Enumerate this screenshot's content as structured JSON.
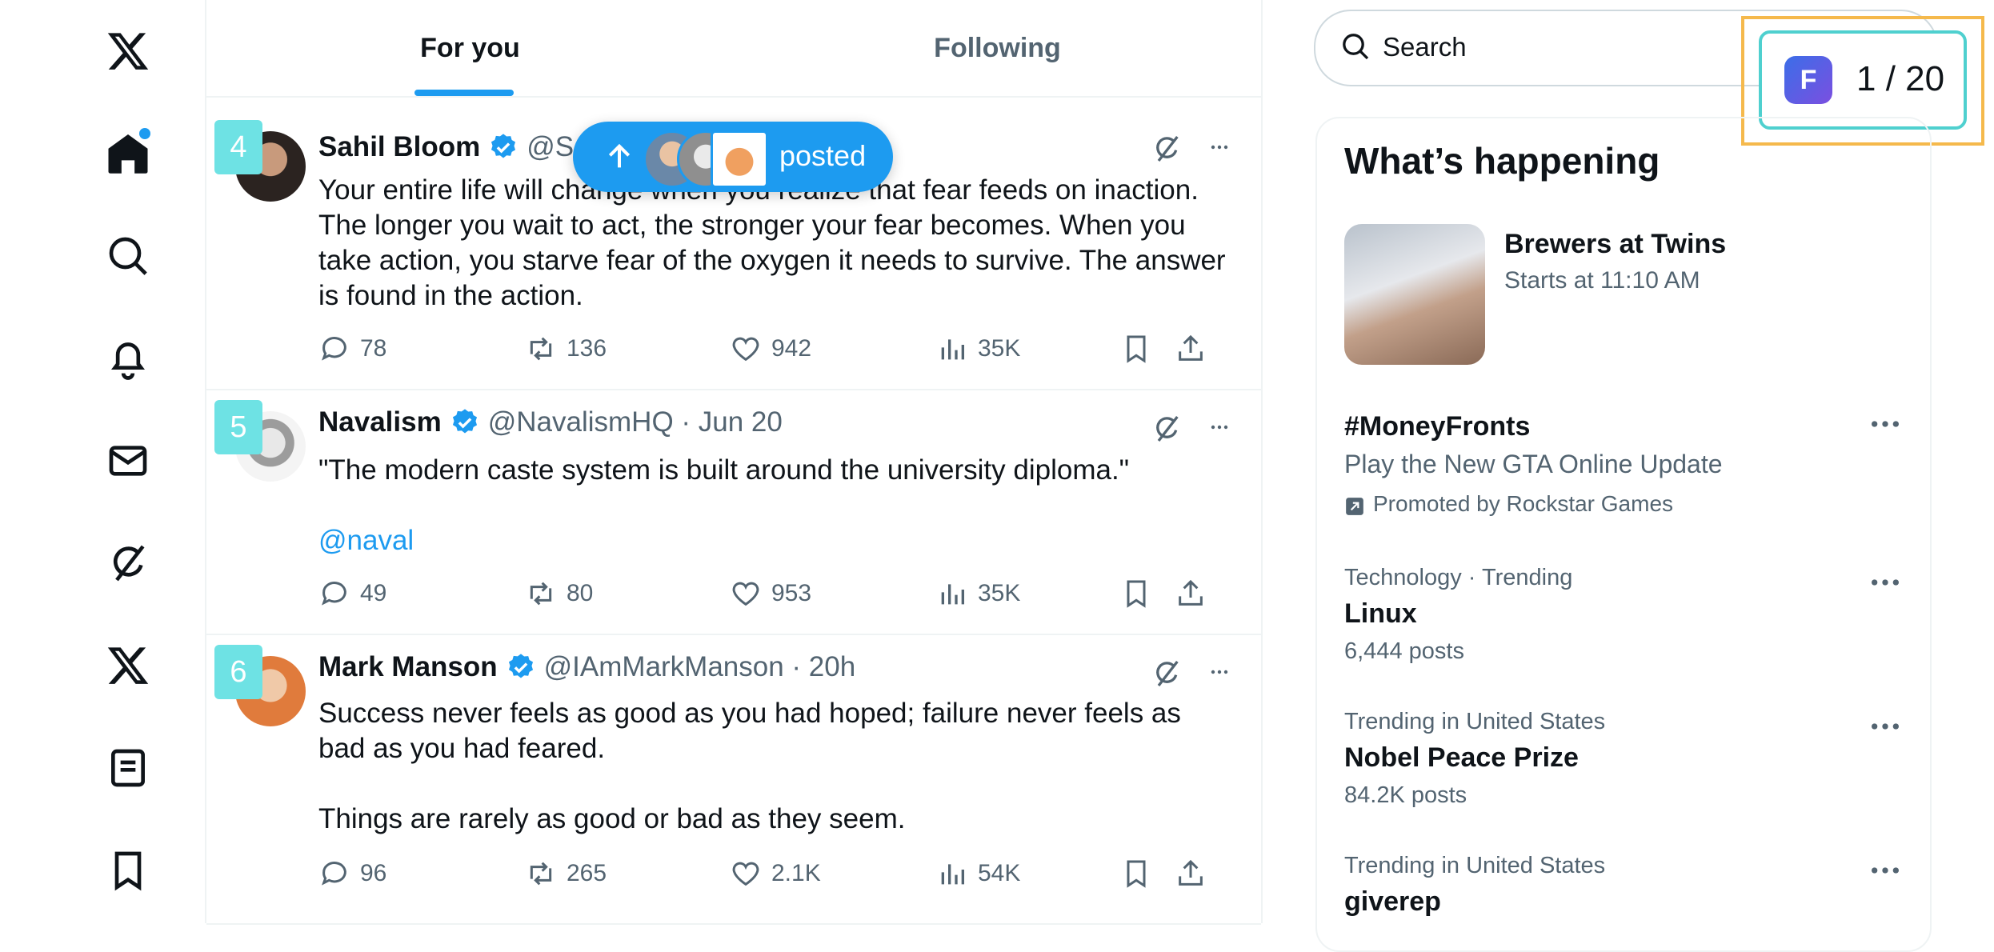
{
  "tabs": {
    "for_you": "For you",
    "following": "Following"
  },
  "posted_pill": {
    "label": "posted"
  },
  "tweets": [
    {
      "badge": "4",
      "name": "Sahil Bloom",
      "handle": "@Sal",
      "text": "Your entire life will change when you realize that fear feeds on inaction. The longer you wait to act, the stronger your fear becomes. When you take action, you starve fear of the oxygen it needs to survive. The answer is found in the action.",
      "replies": "78",
      "reposts": "136",
      "likes": "942",
      "views": "35K"
    },
    {
      "badge": "5",
      "name": "Navalism",
      "handle": "@NavalismHQ · Jun 20",
      "text": "\"The modern caste system is built around the university diploma.\"",
      "link": "@naval",
      "replies": "49",
      "reposts": "80",
      "likes": "953",
      "views": "35K"
    },
    {
      "badge": "6",
      "name": "Mark Manson",
      "handle": "@IAmMarkManson · 20h",
      "text": "Success never feels as good as you had hoped; failure never feels as bad as you had feared.\n\nThings are rarely as good or bad as they seem.",
      "replies": "96",
      "reposts": "265",
      "likes": "2.1K",
      "views": "54K"
    }
  ],
  "search": {
    "placeholder": "Search"
  },
  "counter": {
    "logo_letter": "F",
    "text": "1 / 20"
  },
  "happening": {
    "title": "What’s happening",
    "event": {
      "title": "Brewers at Twins",
      "subtitle": "Starts at 11:10 AM"
    },
    "trends": [
      {
        "title": "#MoneyFronts",
        "subtitle": "Play the New GTA Online Update",
        "promoted": "Promoted by Rockstar Games"
      },
      {
        "meta": "Technology · Trending",
        "title": "Linux",
        "posts": "6,444 posts"
      },
      {
        "meta": "Trending in United States",
        "title": "Nobel Peace Prize",
        "posts": "84.2K posts"
      },
      {
        "meta": "Trending in United States",
        "title": "giverep"
      }
    ]
  },
  "colors": {
    "accent": "#1d9bf0",
    "badge": "#6ee2e4",
    "highlight": "#f5b94c"
  }
}
